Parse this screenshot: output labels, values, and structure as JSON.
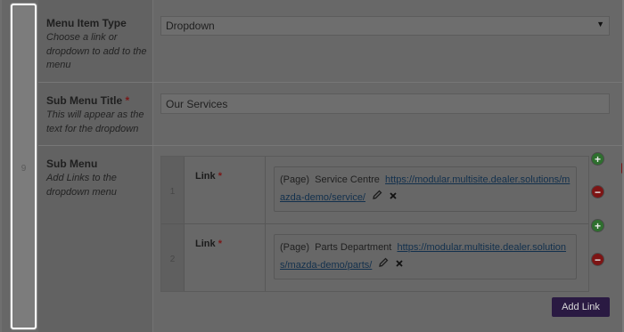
{
  "row_number": "9",
  "menu_item_type": {
    "label": "Menu Item Type",
    "description": "Choose a link or dropdown to add to the menu",
    "selected": "Dropdown"
  },
  "sub_menu_title": {
    "label": "Sub Menu Title",
    "required_mark": "*",
    "description": "This will appear as the text for the dropdown",
    "value": "Our Services"
  },
  "sub_menu": {
    "label": "Sub Menu",
    "description": "Add Links to the dropdown menu",
    "rows": [
      {
        "index": "1",
        "field_label": "Link",
        "required_mark": "*",
        "type": "(Page)",
        "title": "Service Centre",
        "url": "https://modular.multisite.dealer.solutions/mazda-demo/service/"
      },
      {
        "index": "2",
        "field_label": "Link",
        "required_mark": "*",
        "type": "(Page)",
        "title": "Parts Department",
        "url": "https://modular.multisite.dealer.solutions/mazda-demo/parts/"
      }
    ],
    "add_button_label": "Add Link"
  },
  "icons": {
    "add": "plus-circle-icon",
    "remove": "minus-circle-icon",
    "edit": "pencil-icon",
    "clear": "close-icon",
    "dropdown": "chevron-down-icon"
  },
  "colors": {
    "add_green": "#2e6f2e",
    "remove_red": "#7d1414",
    "button_purple": "#2a1a42",
    "link_blue": "#12304d"
  }
}
